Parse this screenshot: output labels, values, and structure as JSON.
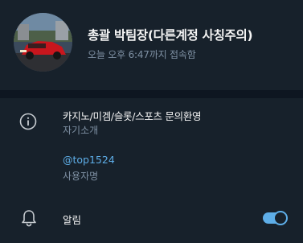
{
  "profile": {
    "name": "총괄 박팀장(다른계정 사칭주의)",
    "status": "오늘 오후 6:47까지 접속함"
  },
  "info": {
    "bio": "카지노/미겜/슬롯/스포츠 문의환영",
    "bio_caption": "자기소개",
    "username": "@top1524",
    "username_caption": "사용자명"
  },
  "notifications": {
    "label": "알림",
    "enabled": true
  },
  "colors": {
    "background": "#17212b",
    "separator": "#0e1621",
    "accent": "#5eaee8",
    "secondary_text": "#7f91a4"
  },
  "icons": {
    "info": "info-circle-icon",
    "notifications": "bell-icon"
  }
}
